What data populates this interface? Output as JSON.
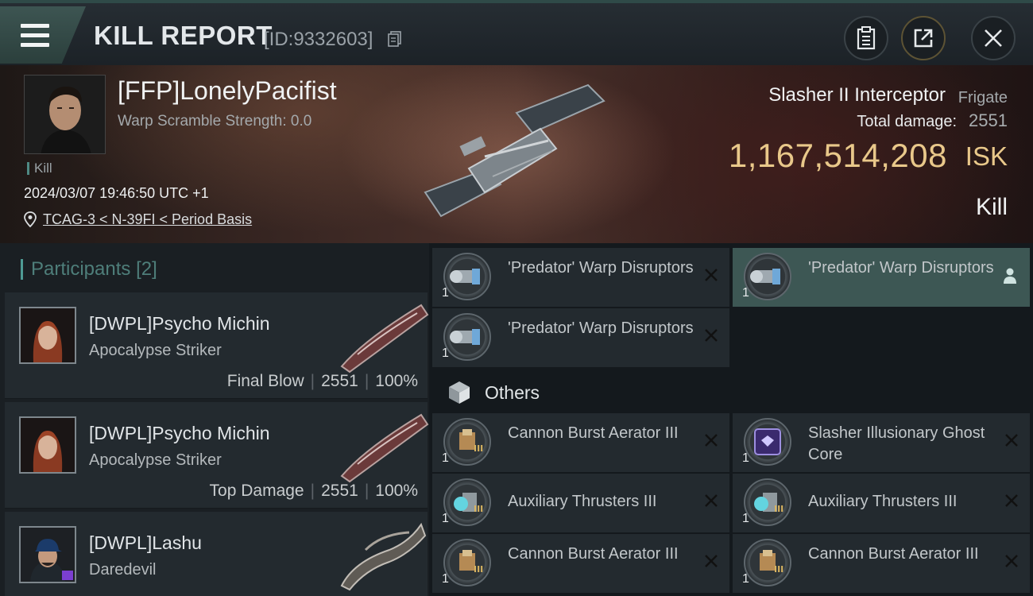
{
  "header": {
    "title": "KILL REPORT",
    "report_id": "[ID:9332603]",
    "icons": {
      "menu": "menu-icon",
      "copy": "copy-icon",
      "clipboard": "clipboard-icon",
      "share": "share-icon",
      "close": "close-icon"
    }
  },
  "victim": {
    "name": "[FFP]LonelyPacifist",
    "warp_scramble": "Warp Scramble Strength: 0.0",
    "tag": "Kill",
    "time": "2024/03/07 19:46:50 UTC +1",
    "location": "TCAG-3 < N-39FI < Period Basis",
    "ship_name": "Slasher II Interceptor",
    "ship_class": "Frigate",
    "damage_label": "Total damage:",
    "damage_value": "2551",
    "isk_value": "1,167,514,208",
    "isk_unit": "ISK",
    "result": "Kill"
  },
  "participants": {
    "header": "Participants",
    "count": "[2]",
    "items": [
      {
        "name": "[DWPL]Psycho Michin",
        "ship": "Apocalypse Striker",
        "label": "Final Blow",
        "damage": "2551",
        "percent": "100%"
      },
      {
        "name": "[DWPL]Psycho Michin",
        "ship": "Apocalypse Striker",
        "label": "Top Damage",
        "damage": "2551",
        "percent": "100%"
      },
      {
        "name": "[DWPL]Lashu",
        "ship": "Daredevil",
        "label": "",
        "damage": "",
        "percent": ""
      }
    ]
  },
  "modules": {
    "warp": [
      {
        "name": "'Predator' Warp Disruptors",
        "qty": "1"
      },
      {
        "name": "'Predator' Warp Disruptors",
        "qty": "1"
      },
      {
        "name": "'Predator' Warp Disruptors",
        "qty": "1"
      }
    ],
    "others_label": "Others",
    "others": [
      {
        "name": "Cannon Burst Aerator III",
        "qty": "1",
        "tier": "III"
      },
      {
        "name": "Slasher Illusionary Ghost Core",
        "qty": "1",
        "tier": ""
      },
      {
        "name": "Auxiliary Thrusters III",
        "qty": "1",
        "tier": "III"
      },
      {
        "name": "Auxiliary Thrusters III",
        "qty": "1",
        "tier": "III"
      },
      {
        "name": "Cannon Burst Aerator III",
        "qty": "1",
        "tier": "III"
      },
      {
        "name": "Cannon Burst Aerator III",
        "qty": "1",
        "tier": "III"
      }
    ]
  },
  "colors": {
    "accent_teal": "#4e9a94",
    "isk_gold": "#e9c88a",
    "highlight_row": "#3d5754"
  }
}
